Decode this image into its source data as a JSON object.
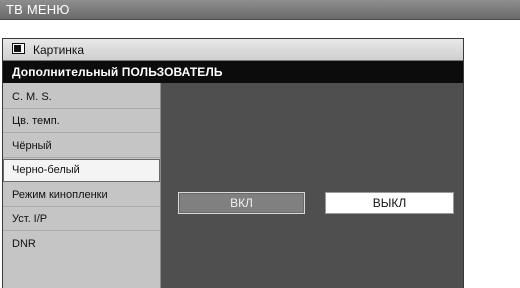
{
  "header": {
    "title": "ТВ МЕНЮ"
  },
  "panel": {
    "picture_label": "Картинка",
    "picture_icon": "picture-icon",
    "section_title": "Дополнительный ПОЛЬЗОВАТЕЛЬ"
  },
  "sidebar": {
    "items": [
      {
        "label": "C. M. S."
      },
      {
        "label": "Цв. темп."
      },
      {
        "label": "Чёрный"
      },
      {
        "label": "Черно-белый",
        "selected": true
      },
      {
        "label": "Режим кинопленки"
      },
      {
        "label": "Уст. I/P"
      },
      {
        "label": "DNR"
      }
    ]
  },
  "options": {
    "on_label": "ВКЛ",
    "off_label": "ВЫКЛ",
    "highlighted": "ВЫКЛ"
  }
}
